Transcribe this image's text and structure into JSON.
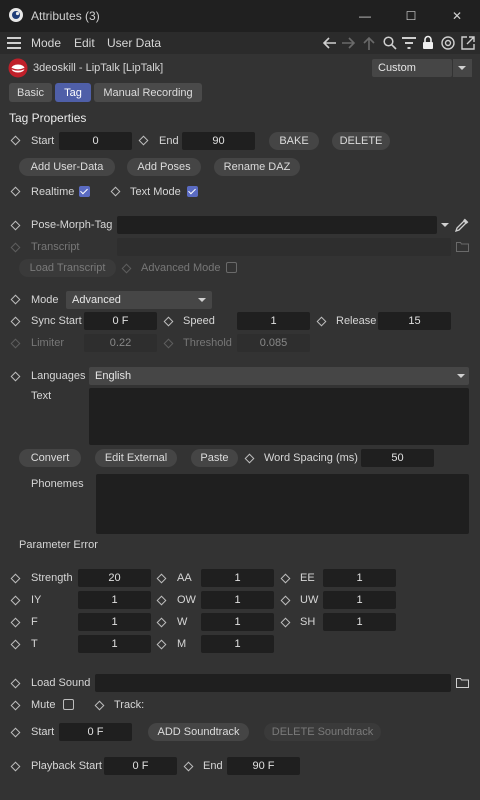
{
  "window": {
    "title": "Attributes (3)",
    "minimize_glyph": "—",
    "maximize_glyph": "☐",
    "close_glyph": "✕"
  },
  "menubar": {
    "items": [
      "Mode",
      "Edit",
      "User Data"
    ]
  },
  "object": {
    "name": "3deoskill - LipTalk [LipTalk]",
    "layer_dropdown": "Custom"
  },
  "tabs": [
    "Basic",
    "Tag",
    "Manual Recording"
  ],
  "section_title": "Tag Properties",
  "row_start_end": {
    "start_label": "Start",
    "start_value": "0",
    "end_label": "End",
    "end_value": "90",
    "bake": "BAKE",
    "delete": "DELETE"
  },
  "row_buttons": {
    "add_user_data": "Add User-Data",
    "add_poses": "Add Poses",
    "rename_daz": "Rename DAZ"
  },
  "row_toggles": {
    "realtime": "Realtime",
    "text_mode": "Text Mode"
  },
  "pose_morph": {
    "label": "Pose-Morph-Tag",
    "value": ""
  },
  "transcript": {
    "label": "Transcript",
    "load": "Load Transcript",
    "advanced_mode": "Advanced Mode"
  },
  "mode": {
    "label": "Mode",
    "value": "Advanced"
  },
  "sync": {
    "sync_start_label": "Sync Start",
    "sync_start_value": "0 F",
    "speed_label": "Speed",
    "speed_value": "1",
    "release_label": "Release",
    "release_value": "15"
  },
  "limiter": {
    "limiter_label": "Limiter",
    "limiter_value": "0.22",
    "threshold_label": "Threshold",
    "threshold_value": "0.085"
  },
  "languages": {
    "label": "Languages",
    "value": "English"
  },
  "text_label": "Text",
  "text_actions": {
    "convert": "Convert",
    "edit_external": "Edit External",
    "paste": "Paste",
    "word_spacing_label": "Word Spacing (ms)",
    "word_spacing_value": "50"
  },
  "phonemes_label": "Phonemes",
  "parameter_error": "Parameter Error",
  "params": [
    {
      "label": "Strength",
      "value": "20"
    },
    {
      "label": "AA",
      "value": "1"
    },
    {
      "label": "EE",
      "value": "1"
    },
    {
      "label": "IY",
      "value": "1"
    },
    {
      "label": "OW",
      "value": "1"
    },
    {
      "label": "UW",
      "value": "1"
    },
    {
      "label": "F",
      "value": "1"
    },
    {
      "label": "W",
      "value": "1"
    },
    {
      "label": "SH",
      "value": "1"
    },
    {
      "label": "T",
      "value": "1"
    },
    {
      "label": "M",
      "value": "1"
    }
  ],
  "sound": {
    "load_sound_label": "Load Sound",
    "mute_label": "Mute",
    "track_label": "Track:",
    "start_label": "Start",
    "start_value": "0 F",
    "add_soundtrack": "ADD Soundtrack",
    "delete_soundtrack": "DELETE Soundtrack"
  },
  "playback": {
    "start_label": "Playback Start",
    "start_value": "0 F",
    "end_label": "End",
    "end_value": "90 F"
  },
  "colors": {
    "accent": "#4f5fa8",
    "background": "#333333",
    "field": "#1f1f1f",
    "titlebar": "#202020"
  }
}
